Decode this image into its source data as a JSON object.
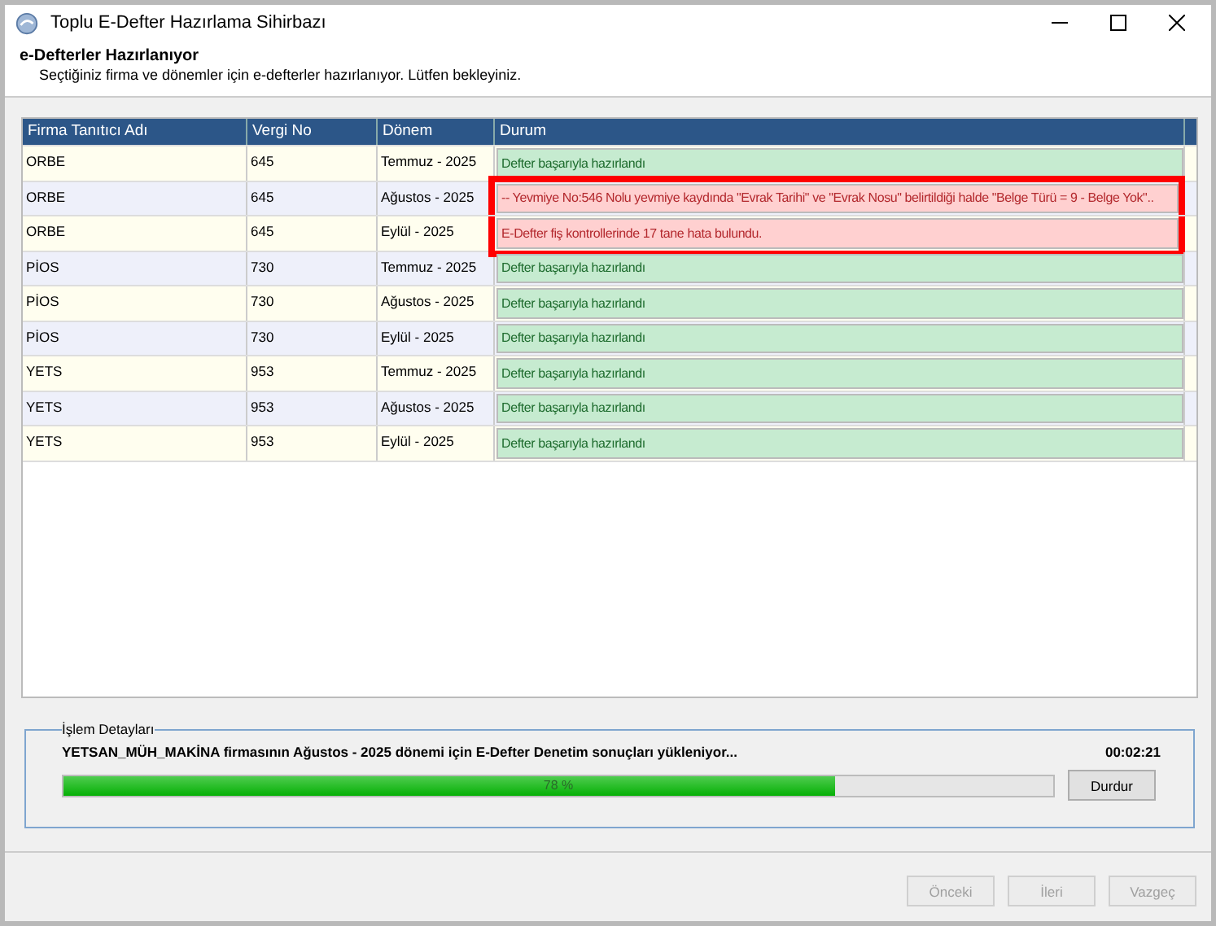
{
  "window": {
    "title": "Toplu E-Defter Hazırlama Sihirbazı"
  },
  "header": {
    "title": "e-Defterler Hazırlanıyor",
    "subtitle": "Seçtiğiniz firma ve dönemler için e-defterler hazırlanıyor. Lütfen bekleyiniz."
  },
  "table": {
    "columns": [
      "Firma Tanıtıcı Adı",
      "Vergi No",
      "Dönem",
      "Durum"
    ],
    "rows": [
      {
        "firm": "ORBE",
        "tax_no": "645",
        "period": "Temmuz - 2025",
        "status": "Defter başarıyla hazırlandı",
        "kind": "ok",
        "highlighted": false
      },
      {
        "firm": "ORBE",
        "tax_no": "645",
        "period": "Ağustos - 2025",
        "status": "-- Yevmiye No:546 Nolu yevmiye kaydında \"Evrak Tarihi\" ve \"Evrak Nosu\" belirtildiği halde \"Belge Türü = 9 - Belge Yok\"..",
        "kind": "error",
        "highlighted": true
      },
      {
        "firm": "ORBE",
        "tax_no": "645",
        "period": "Eylül - 2025",
        "status": "E-Defter fiş kontrollerinde 17 tane hata bulundu.",
        "kind": "error",
        "highlighted": true
      },
      {
        "firm": "PİOS",
        "tax_no": "730",
        "period": "Temmuz - 2025",
        "status": "Defter başarıyla hazırlandı",
        "kind": "ok",
        "highlighted": false
      },
      {
        "firm": "PİOS",
        "tax_no": "730",
        "period": "Ağustos - 2025",
        "status": "Defter başarıyla hazırlandı",
        "kind": "ok",
        "highlighted": false
      },
      {
        "firm": "PİOS",
        "tax_no": "730",
        "period": "Eylül - 2025",
        "status": "Defter başarıyla hazırlandı",
        "kind": "ok",
        "highlighted": false
      },
      {
        "firm": "YETS",
        "tax_no": "953",
        "period": "Temmuz - 2025",
        "status": "Defter başarıyla hazırlandı",
        "kind": "ok",
        "highlighted": false
      },
      {
        "firm": "YETS",
        "tax_no": "953",
        "period": "Ağustos - 2025",
        "status": "Defter başarıyla hazırlandı",
        "kind": "ok",
        "highlighted": false
      },
      {
        "firm": "YETS",
        "tax_no": "953",
        "period": "Eylül - 2025",
        "status": "Defter başarıyla hazırlandı",
        "kind": "ok",
        "highlighted": false
      }
    ]
  },
  "details": {
    "legend": "İşlem Detayları",
    "message": "YETSAN_MÜH_MAKİNA firmasının Ağustos - 2025 dönemi için E-Defter Denetim sonuçları yükleniyor...",
    "elapsed": "00:02:21",
    "progress": {
      "level": 0.78,
      "reading": "78 %"
    },
    "stop_button": "Durdur"
  },
  "buttons": [
    {
      "label": "Önceki",
      "disabled": true
    },
    {
      "label": "İleri",
      "disabled": true
    },
    {
      "label": "Vazgeç",
      "disabled": true
    }
  ]
}
